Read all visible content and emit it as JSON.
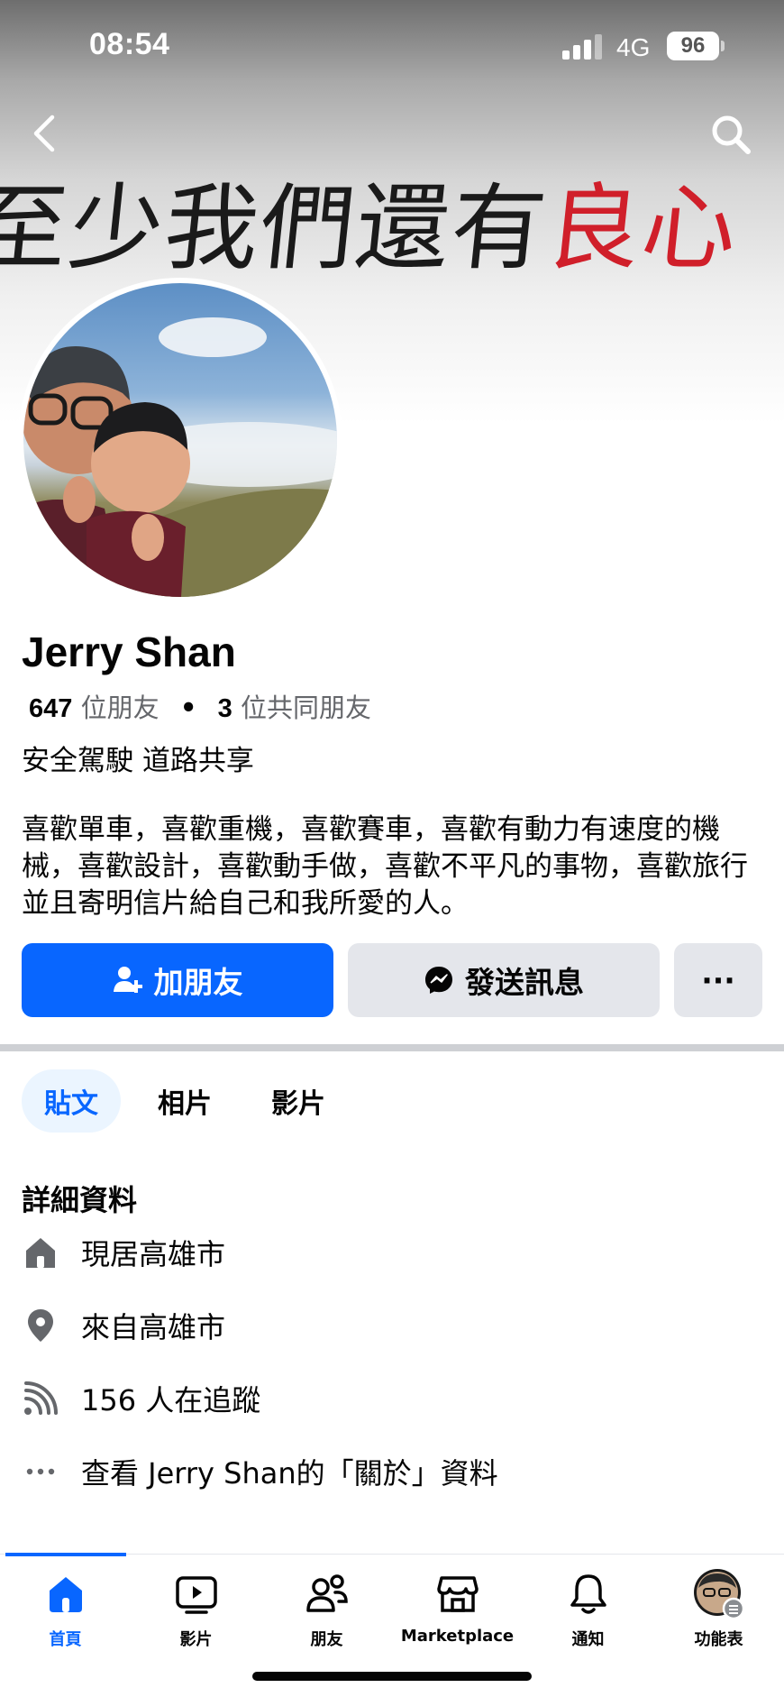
{
  "status_bar": {
    "time": "08:54",
    "network": "4G",
    "battery": "96"
  },
  "cover": {
    "handwriting": "至少我們還有",
    "handwriting_red": "良心"
  },
  "profile": {
    "name": "Jerry Shan",
    "friends_count": "647",
    "friends_label": "位朋友",
    "mutual_count": "3",
    "mutual_label": "位共同朋友",
    "bio_short": "安全駕駛 道路共享",
    "bio_long": "喜歡單車，喜歡重機，喜歡賽車，喜歡有動力有速度的機械，喜歡設計，喜歡動手做，喜歡不平凡的事物，喜歡旅行並且寄明信片給自己和我所愛的人。"
  },
  "actions": {
    "add_friend": "加朋友",
    "message": "發送訊息",
    "more": "···"
  },
  "tabs": [
    {
      "label": "貼文"
    },
    {
      "label": "相片"
    },
    {
      "label": "影片"
    }
  ],
  "details": {
    "title": "詳細資料",
    "items": [
      {
        "icon": "home-icon",
        "text": "現居高雄市"
      },
      {
        "icon": "location-pin-icon",
        "text": "來自高雄市"
      },
      {
        "icon": "rss-icon",
        "text": "156 人在追蹤"
      },
      {
        "icon": "more-dots-icon",
        "text": "查看 Jerry Shan的「關於」資料"
      }
    ]
  },
  "bottom_nav": [
    {
      "label": "首頁",
      "icon": "home-icon"
    },
    {
      "label": "影片",
      "icon": "video-icon"
    },
    {
      "label": "朋友",
      "icon": "friends-icon"
    },
    {
      "label": "Marketplace",
      "icon": "marketplace-icon"
    },
    {
      "label": "通知",
      "icon": "bell-icon"
    },
    {
      "label": "功能表",
      "icon": "menu-avatar-icon"
    }
  ],
  "colors": {
    "accent": "#0866ff",
    "secondary_button": "#e4e6eb",
    "muted_text": "#65676b",
    "tab_active_bg": "#ebf5ff"
  }
}
